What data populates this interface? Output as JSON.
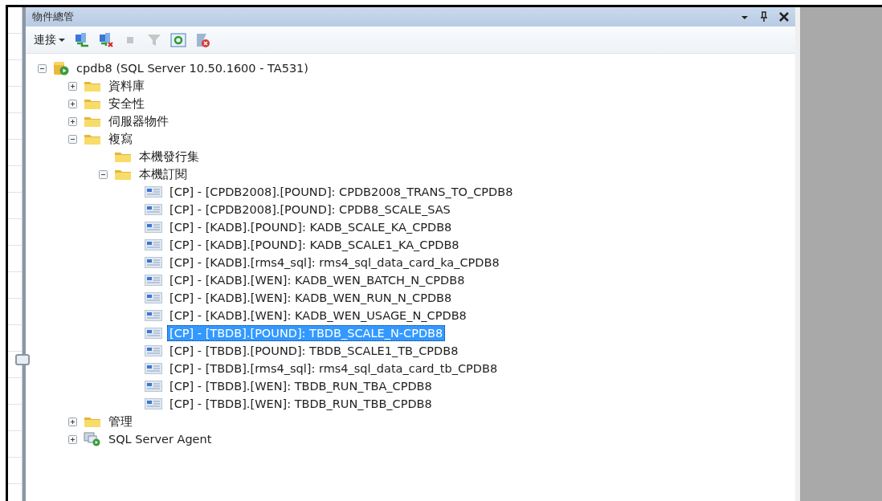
{
  "panel": {
    "title": "物件總管"
  },
  "toolbar": {
    "connect_label": "連接",
    "buttons": [
      {
        "kind": "connect",
        "disabled": false
      },
      {
        "kind": "disconnect",
        "disabled": false
      },
      {
        "kind": "stop",
        "disabled": true
      },
      {
        "kind": "filter",
        "disabled": true
      },
      {
        "kind": "refresh",
        "disabled": false
      },
      {
        "kind": "activity",
        "disabled": false
      }
    ]
  },
  "tree": [
    {
      "kind": "server",
      "label": "cpdb8 (SQL Server 10.50.1600 - TA531)",
      "expanded": true,
      "selected": false,
      "children": [
        {
          "kind": "folder",
          "label": "資料庫",
          "expanded": false,
          "selected": false
        },
        {
          "kind": "folder",
          "label": "安全性",
          "expanded": false,
          "selected": false
        },
        {
          "kind": "folder",
          "label": "伺服器物件",
          "expanded": false,
          "selected": false
        },
        {
          "kind": "folder",
          "label": "複寫",
          "expanded": true,
          "selected": false,
          "children": [
            {
              "kind": "folder",
              "label": "本機發行集",
              "selected": false
            },
            {
              "kind": "folder",
              "label": "本機訂閱",
              "expanded": true,
              "selected": false,
              "children": [
                {
                  "kind": "subscription",
                  "label": "[CP] - [CPDB2008].[POUND]: CPDB2008_TRANS_TO_CPDB8",
                  "selected": false
                },
                {
                  "kind": "subscription",
                  "label": "[CP] - [CPDB2008].[POUND]: CPDB8_SCALE_SAS",
                  "selected": false
                },
                {
                  "kind": "subscription",
                  "label": "[CP] - [KADB].[POUND]: KADB_SCALE_KA_CPDB8",
                  "selected": false
                },
                {
                  "kind": "subscription",
                  "label": "[CP] - [KADB].[POUND]: KADB_SCALE1_KA_CPDB8",
                  "selected": false
                },
                {
                  "kind": "subscription",
                  "label": "[CP] - [KADB].[rms4_sql]: rms4_sql_data_card_ka_CPDB8",
                  "selected": false
                },
                {
                  "kind": "subscription",
                  "label": "[CP] - [KADB].[WEN]: KADB_WEN_BATCH_N_CPDB8",
                  "selected": false
                },
                {
                  "kind": "subscription",
                  "label": "[CP] - [KADB].[WEN]: KADB_WEN_RUN_N_CPDB8",
                  "selected": false
                },
                {
                  "kind": "subscription",
                  "label": "[CP] - [KADB].[WEN]: KADB_WEN_USAGE_N_CPDB8",
                  "selected": false
                },
                {
                  "kind": "subscription",
                  "label": "[CP] - [TBDB].[POUND]: TBDB_SCALE_N-CPDB8",
                  "selected": true
                },
                {
                  "kind": "subscription",
                  "label": "[CP] - [TBDB].[POUND]: TBDB_SCALE1_TB_CPDB8",
                  "selected": false
                },
                {
                  "kind": "subscription",
                  "label": "[CP] - [TBDB].[rms4_sql]: rms4_sql_data_card_tb_CPDB8",
                  "selected": false
                },
                {
                  "kind": "subscription",
                  "label": "[CP] - [TBDB].[WEN]: TBDB_RUN_TBA_CPDB8",
                  "selected": false
                },
                {
                  "kind": "subscription",
                  "label": "[CP] - [TBDB].[WEN]: TBDB_RUN_TBB_CPDB8",
                  "selected": false
                }
              ]
            }
          ]
        },
        {
          "kind": "folder",
          "label": "管理",
          "expanded": false,
          "selected": false
        },
        {
          "kind": "agent",
          "label": "SQL Server Agent",
          "expanded": false,
          "selected": false
        }
      ]
    }
  ]
}
